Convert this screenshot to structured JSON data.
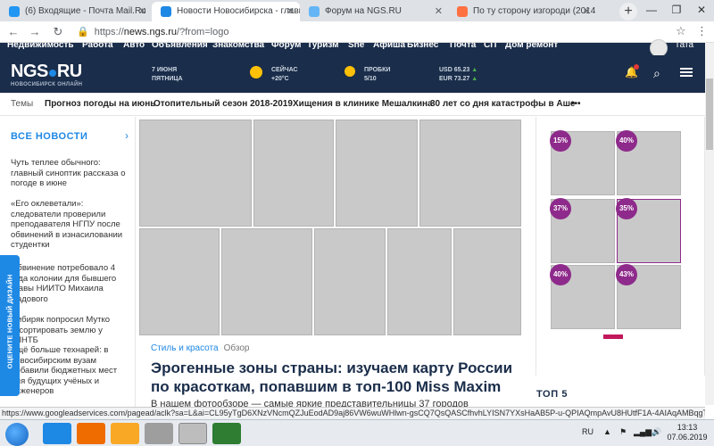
{
  "browser": {
    "tabs": [
      {
        "title": "(6) Входящие - Почта Mail.Ru",
        "active": false
      },
      {
        "title": "Новости Новосибирска - главн",
        "active": true
      },
      {
        "title": "Форум на NGS.RU",
        "active": false
      },
      {
        "title": "По ту сторону изгороди (2014",
        "active": false
      }
    ],
    "url_scheme": "https://",
    "url_host": "news.ngs.ru",
    "url_path": "/?from=logo"
  },
  "site_nav": {
    "items": [
      "Недвижимость",
      "Работа",
      "Авто",
      "Объявления",
      "Знакомства",
      "Форум",
      "Туризм",
      "Sne",
      "Афиша",
      "Бизнес",
      "Почта",
      "СП",
      "Дом ремонт"
    ],
    "user": "Тата"
  },
  "header": {
    "logo": "NGS",
    "logo_ru": "RU",
    "logo_sub": "НОВОСИБИРСК ОНЛАЙН",
    "date_line1": "7 ИЮНЯ",
    "date_line2": "ПЯТНИЦА",
    "weather_line1": "СЕЙЧАС",
    "weather_line2": "+20°C",
    "traffic_line1": "ПРОБКИ",
    "traffic_line2": "5/10",
    "usd": "USD 65.23",
    "eur": "EUR 73.27"
  },
  "topics": {
    "label": "Темы",
    "items": [
      "Прогноз погоды на июнь",
      "Отопительный сезон 2018-2019",
      "Хищения в клинике Мешалкина",
      "30 лет со дня катастрофы в Аше"
    ],
    "more": "•••"
  },
  "news": {
    "heading": "ВСЕ НОВОСТИ",
    "items": [
      "Чуть теплее обычного: главный синоптик рассказа о погоде в июне",
      "«Его оклеветали»: следователи проверили преподавателя НГПУ после обвинений в изнасиловании студентки",
      "Обвинение потребовало 4 года колонии для бывшего главы НИИТО Михаила Садового",
      "Сибиряк попросил Мутко отсортировать землю у ГПНТБ",
      "Ещё больше технарей: в новосибирским вузам добавили бюджетных мест для будущих учёных и инженеров"
    ],
    "side_button": "ОЦЕНИТЕ НОВЫЙ ДИЗАЙН"
  },
  "article": {
    "rubric": "Стиль и красота",
    "type": "Обзор",
    "title": "Эрогенные зоны страны: изучаем карту России по красоткам, попавшим в топ-100 Miss Maxim",
    "lead": "В нашем фотообзоре — самые яркие представительницы 37 городов"
  },
  "ads": {
    "badges": [
      "15%",
      "40%",
      "37%",
      "35%",
      "40%",
      "43%"
    ]
  },
  "sidebar": {
    "top5": "ТОП 5"
  },
  "status_url": "https://www.googleadservices.com/pagead/aclk?sa=L&ai=CL95yTgD6XNzVNcmQZJuEodAD9aj86VW6wuWHlwn-gsCQ7QsQASCfhvhLYISN7YXsHaAB5P-u-QPIAQmpAvU8HUtfF1A-4AIAqAMBqgTOAU_QPVMG78...",
  "taskbar": {
    "lang": "RU",
    "time": "13:13",
    "date": "07.06.2019"
  },
  "colors": {
    "brand_navy": "#1a2d4a",
    "accent_blue": "#1e88e5",
    "badge_purple": "#8e2a8b"
  }
}
